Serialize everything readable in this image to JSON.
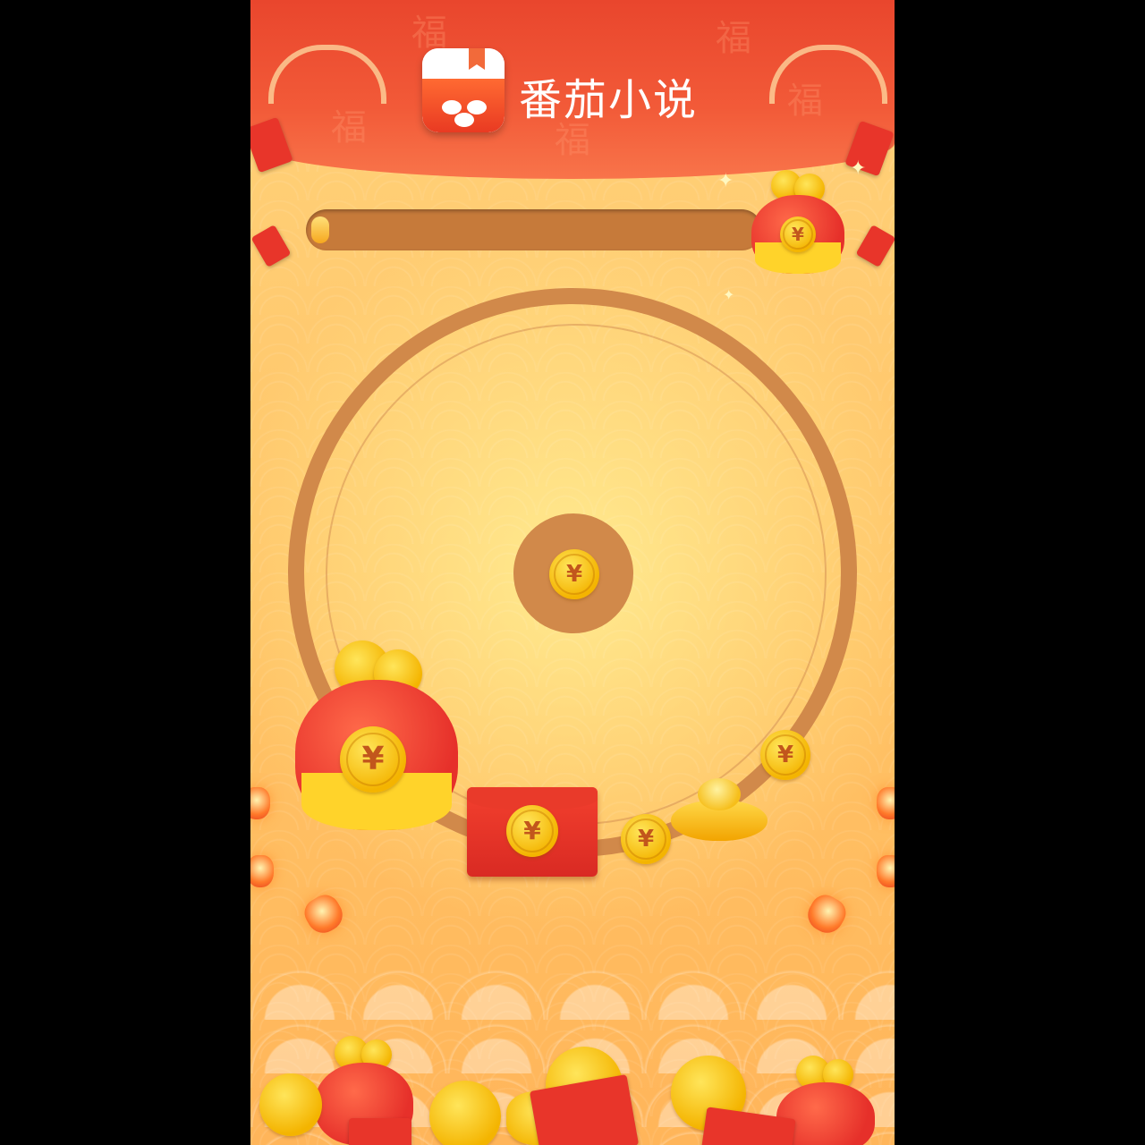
{
  "app": {
    "brand_name": "番茄小说",
    "logo_icon": "tomato-book-logo",
    "colors": {
      "header_red": "#e9462d",
      "background_gold": "#ffc265",
      "ring_brown": "#d1894a",
      "coin_gold": "#f4b400"
    }
  },
  "progress": {
    "value_fraction": 0.04
  },
  "reward_icon": {
    "symbol": "¥"
  },
  "board": {
    "center_coin_symbol": "¥",
    "prize_symbols": {
      "lucky_bag": "¥",
      "red_envelope": "¥",
      "coin_1": "¥",
      "coin_2": "¥"
    }
  },
  "decor": {
    "pattern_char": "福"
  }
}
